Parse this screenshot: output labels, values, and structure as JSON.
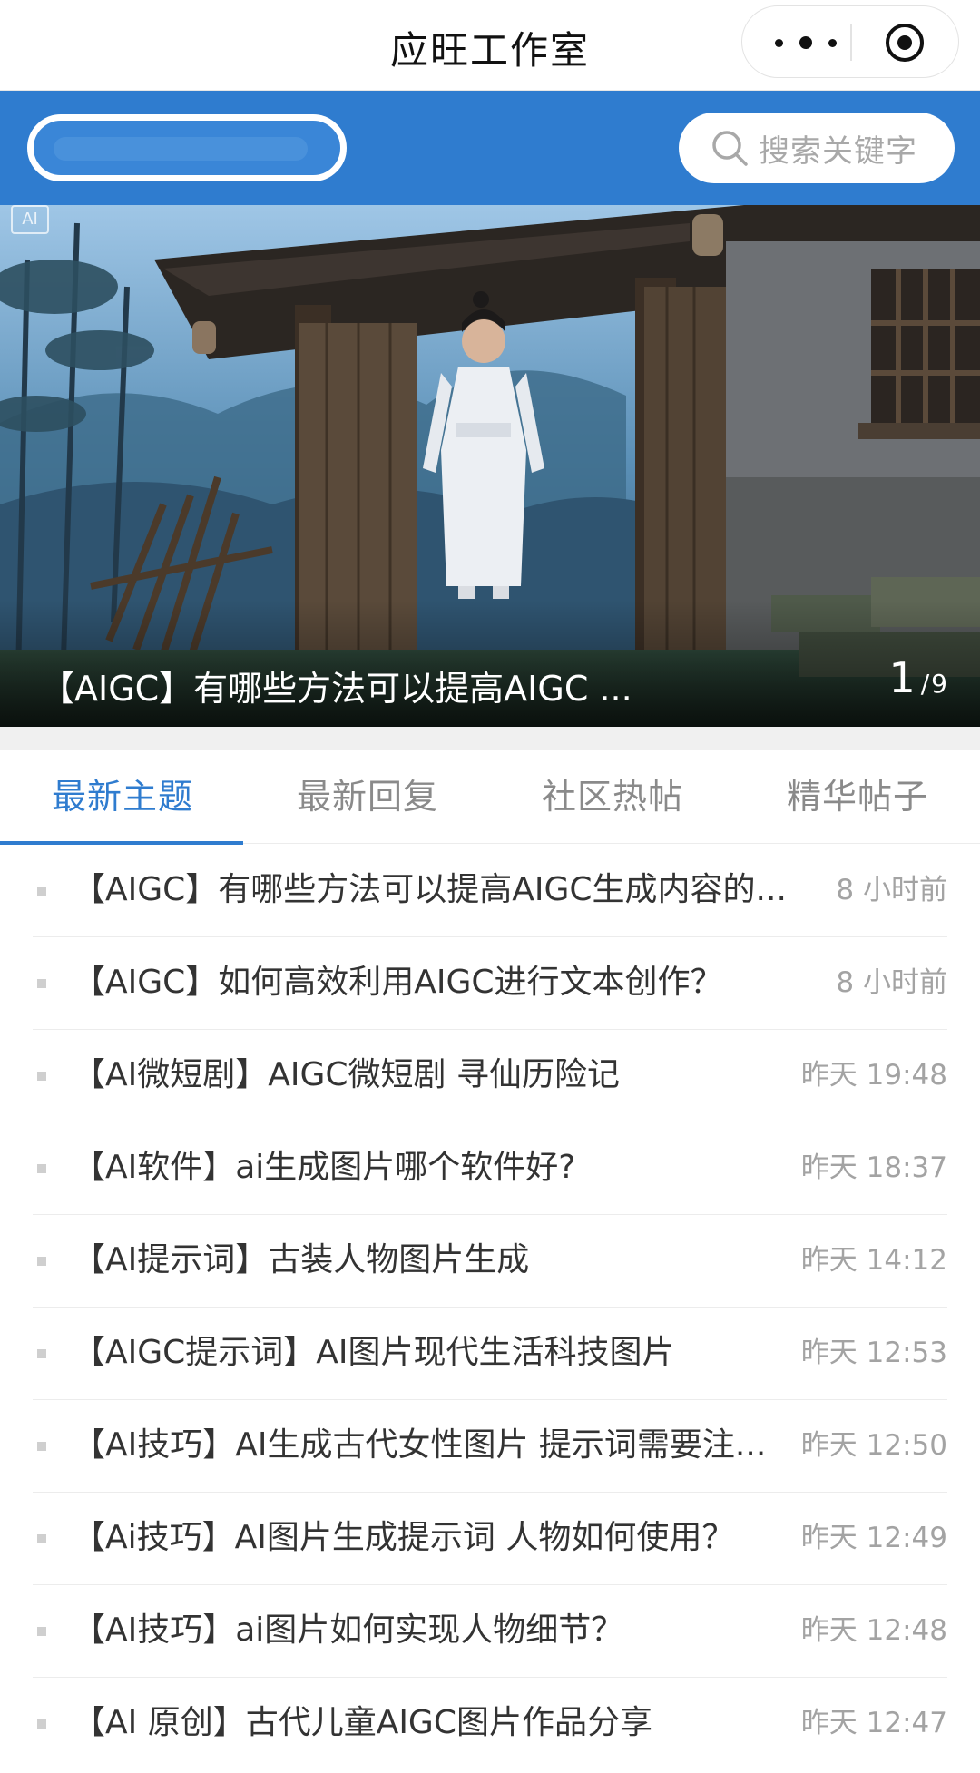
{
  "app": {
    "title": "应旺工作室"
  },
  "search": {
    "placeholder": "搜索关键字"
  },
  "icons": {
    "menu": "more-dots-icon",
    "close": "target-icon",
    "search": "search-icon",
    "ai_mark": "ai-mark-icon"
  },
  "colors": {
    "brand": "#2f7ccf",
    "active_tab": "#2f7ccf",
    "text": "#333333",
    "muted": "#a3a3a3"
  },
  "banner": {
    "ai_mark": "AI",
    "caption": "【AIGC】有哪些方法可以提高AIGC ...",
    "current": "1",
    "separator": "/",
    "total": "9"
  },
  "tabs": [
    {
      "label": "最新主题",
      "active": true
    },
    {
      "label": "最新回复",
      "active": false
    },
    {
      "label": "社区热帖",
      "active": false
    },
    {
      "label": "精华帖子",
      "active": false
    }
  ],
  "posts": [
    {
      "title": "【AIGC】有哪些方法可以提高AIGC生成内容的...",
      "time": "8 小时前"
    },
    {
      "title": "【AIGC】如何高效利用AIGC进行文本创作？",
      "time": "8 小时前"
    },
    {
      "title": "【AI微短剧】AIGC微短剧 寻仙历险记",
      "time": "昨天 19:48"
    },
    {
      "title": "【AI软件】ai生成图片哪个软件好?",
      "time": "昨天 18:37"
    },
    {
      "title": "【AI提示词】古装人物图片生成",
      "time": "昨天 14:12"
    },
    {
      "title": "【AIGC提示词】AI图片现代生活科技图片",
      "time": "昨天 12:53"
    },
    {
      "title": "【AI技巧】AI生成古代女性图片 提示词需要注...",
      "time": "昨天 12:50"
    },
    {
      "title": "【Ai技巧】AI图片生成提示词 人物如何使用？",
      "time": "昨天 12:49"
    },
    {
      "title": "【AI技巧】ai图片如何实现人物细节？",
      "time": "昨天 12:48"
    },
    {
      "title": "【AI 原创】古代儿童AIGC图片作品分享",
      "time": "昨天 12:47"
    }
  ]
}
